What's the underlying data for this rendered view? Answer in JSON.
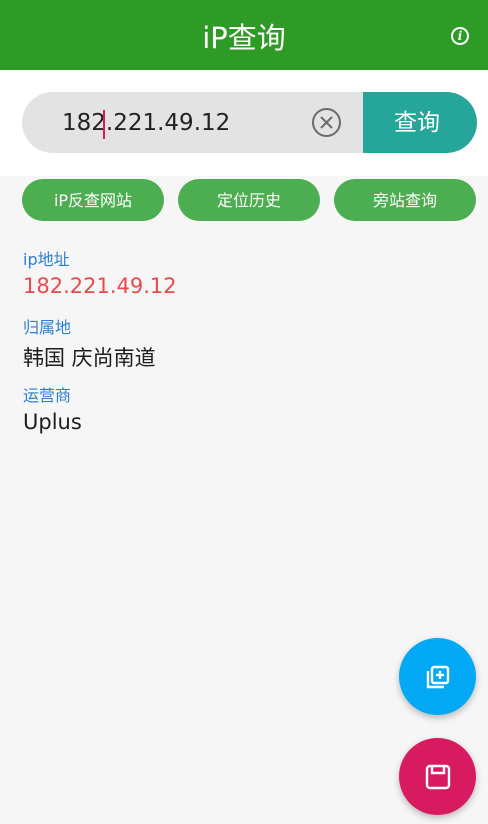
{
  "app_bar": {
    "title": "iP查询",
    "info_icon": "info-icon",
    "info_glyph": "i",
    "color": "#2e9b27"
  },
  "search": {
    "value": "182.221.49.12",
    "clear_icon": "clear-circle-icon",
    "button_label": "查询",
    "button_color": "#26a69a"
  },
  "chips": [
    {
      "label": "iP反查网站"
    },
    {
      "label": "定位历史"
    },
    {
      "label": "旁站查询"
    }
  ],
  "result": {
    "ip_label": "ip地址",
    "ip_value": "182.221.49.12",
    "location_label": "归属地",
    "location_value": "韩国 庆尚南道",
    "isp_label": "运营商",
    "isp_value": "Uplus"
  },
  "fabs": {
    "copy": {
      "icon": "copy-add-icon",
      "color": "#03a9f4"
    },
    "save": {
      "icon": "save-icon",
      "color": "#d81b60"
    }
  }
}
